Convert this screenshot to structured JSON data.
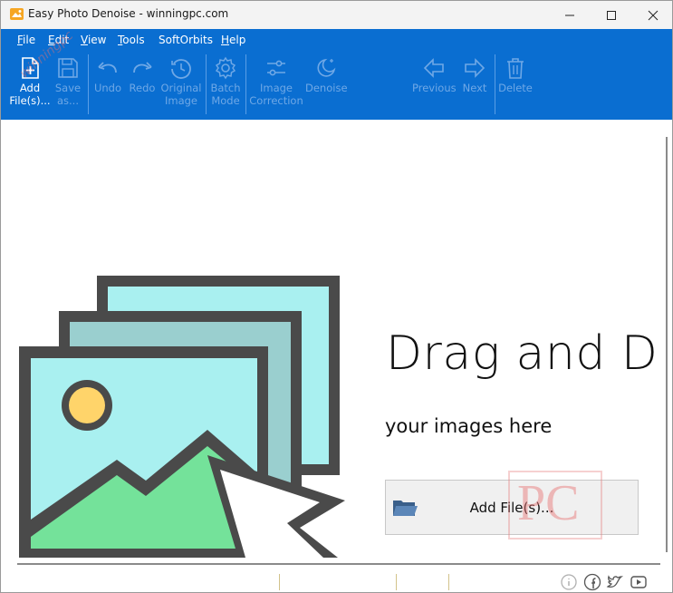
{
  "window": {
    "title": "Easy Photo Denoise - winningpc.com"
  },
  "menu": [
    {
      "label": "File",
      "underline": "F",
      "rest": "ile"
    },
    {
      "label": "Edit",
      "underline": "E",
      "rest": "dit"
    },
    {
      "label": "View",
      "underline": "V",
      "rest": "iew"
    },
    {
      "label": "Tools",
      "underline": "T",
      "rest": "ools"
    },
    {
      "label": "SoftOrbits",
      "underline": "",
      "rest": "SoftOrbits"
    },
    {
      "label": "Help",
      "underline": "H",
      "rest": "elp"
    }
  ],
  "toolbar": {
    "add_files": {
      "line1": "Add",
      "line2": "File(s)...",
      "icon": "add-file-icon"
    },
    "save_as": {
      "line1": "Save",
      "line2": "as...",
      "icon": "save-icon"
    },
    "undo": {
      "line1": "Undo",
      "icon": "undo-icon"
    },
    "redo": {
      "line1": "Redo",
      "icon": "redo-icon"
    },
    "original_image": {
      "line1": "Original",
      "line2": "Image",
      "icon": "history-icon"
    },
    "batch_mode": {
      "line1": "Batch",
      "line2": "Mode",
      "icon": "gear-icon"
    },
    "image_correction": {
      "line1": "Image",
      "line2": "Correction",
      "icon": "sliders-icon"
    },
    "denoise": {
      "line1": "Denoise",
      "icon": "moon-stars-icon"
    },
    "previous": {
      "line1": "Previous",
      "icon": "arrow-left-icon"
    },
    "next": {
      "line1": "Next",
      "icon": "arrow-right-icon"
    },
    "delete": {
      "line1": "Delete",
      "icon": "trash-icon"
    }
  },
  "drop_zone": {
    "title": "Drag and Drop",
    "subtitle": "your images here",
    "add_button_label": "Add File(s)..."
  },
  "watermark": {
    "text": "PC",
    "diagonal": "winningpc"
  },
  "colors": {
    "ribbon": "#0a6ed1",
    "disabled": "#6fa8e6",
    "frame": "#4a4a4a",
    "photo_bg": "#a9f0f0",
    "mountain": "#74e29a",
    "sun": "#ffd46a"
  }
}
